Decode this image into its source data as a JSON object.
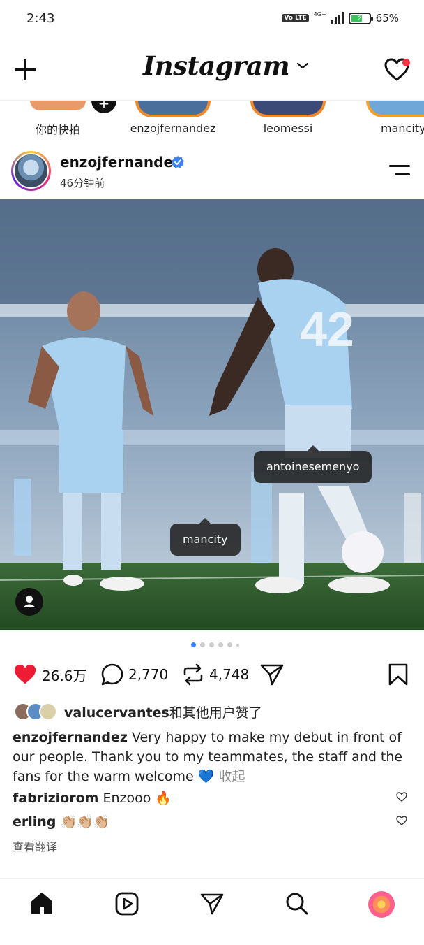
{
  "status_bar": {
    "time": "2:43",
    "volte": "Vo LTE",
    "network": "4G+",
    "battery_percent": "65%",
    "battery_level": 0.65,
    "battery_color": "#38c25a"
  },
  "header": {
    "logo": "Instagram",
    "notification_dot_color": "#ff3040"
  },
  "stories": [
    {
      "label": "你的快拍"
    },
    {
      "label": "enzojfernandez"
    },
    {
      "label": "leomessi"
    },
    {
      "label": "mancity"
    }
  ],
  "post": {
    "username": "enzojfernandez",
    "verified": true,
    "time_ago": "46分钟前",
    "tags": {
      "player": "antoinesemenyo",
      "club": "mancity"
    },
    "carousel": {
      "count": 6,
      "active_index": 0
    },
    "likes": "26.6万",
    "comments": "2,770",
    "reposts": "4,748",
    "liked_by": {
      "user": "valucervantes",
      "suffix": "和其他用户赞了"
    },
    "caption": {
      "username": "enzojfernandez",
      "text": "Very happy to make my debut in front of our people. Thank you to my teammates, the staff and the fans for the warm welcome",
      "emoji": "💙",
      "collapse_label": "收起"
    },
    "comments_preview": [
      {
        "user": "fabriziorom",
        "text": "Enzooo 🔥"
      },
      {
        "user": "erling",
        "text": "👏🏼👏🏼👏🏼"
      }
    ],
    "translate_label": "查看翻译",
    "like_color": "#ed1b33",
    "accent_color": "#3c82f6"
  },
  "bottom_nav": [
    {
      "icon": "home-icon"
    },
    {
      "icon": "reels-icon"
    },
    {
      "icon": "send-icon"
    },
    {
      "icon": "search-icon"
    },
    {
      "icon": "profile-avatar"
    }
  ]
}
